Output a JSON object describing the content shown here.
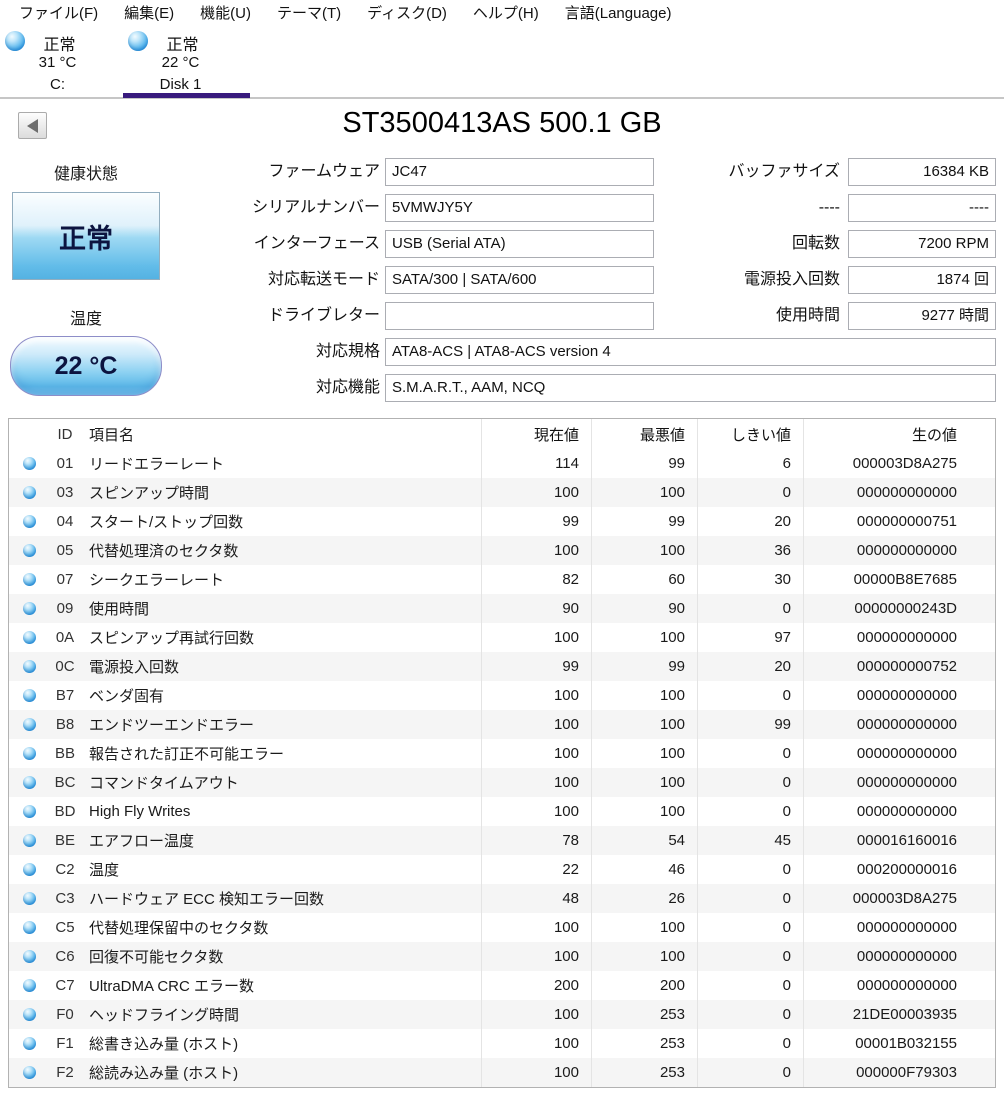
{
  "menu": {
    "items": [
      "ファイル(F)",
      "編集(E)",
      "機能(U)",
      "テーマ(T)",
      "ディスク(D)",
      "ヘルプ(H)",
      "言語(Language)"
    ]
  },
  "disk_tabs": [
    {
      "status": "正常",
      "temp": "31 °C",
      "name": "C:",
      "selected": false
    },
    {
      "status": "正常",
      "temp": "22 °C",
      "name": "Disk 1",
      "selected": true
    }
  ],
  "header": {
    "title": "ST3500413AS 500.1 GB"
  },
  "health": {
    "label": "健康状態",
    "status": "正常"
  },
  "temperature": {
    "label": "温度",
    "value": "22 °C"
  },
  "info_left": [
    {
      "label": "ファームウェア",
      "value": "JC47"
    },
    {
      "label": "シリアルナンバー",
      "value": "5VMWJY5Y"
    },
    {
      "label": "インターフェース",
      "value": "USB (Serial ATA)"
    },
    {
      "label": "対応転送モード",
      "value": "SATA/300 | SATA/600"
    },
    {
      "label": "ドライブレター",
      "value": ""
    }
  ],
  "info_right": [
    {
      "label": "バッファサイズ",
      "value": "16384 KB"
    },
    {
      "label": "----",
      "value": "----"
    },
    {
      "label": "回転数",
      "value": "7200 RPM"
    },
    {
      "label": "電源投入回数",
      "value": "1874 回"
    },
    {
      "label": "使用時間",
      "value": "9277 時間"
    }
  ],
  "info_wide": [
    {
      "label": "対応規格",
      "value": "ATA8-ACS | ATA8-ACS version 4"
    },
    {
      "label": "対応機能",
      "value": "S.M.A.R.T., AAM, NCQ"
    }
  ],
  "smart_table": {
    "headers": {
      "id": "ID",
      "name": "項目名",
      "current": "現在値",
      "worst": "最悪値",
      "threshold": "しきい値",
      "raw": "生の値"
    },
    "rows": [
      {
        "id": "01",
        "name": "リードエラーレート",
        "current": "114",
        "worst": "99",
        "threshold": "6",
        "raw": "000003D8A275"
      },
      {
        "id": "03",
        "name": "スピンアップ時間",
        "current": "100",
        "worst": "100",
        "threshold": "0",
        "raw": "000000000000"
      },
      {
        "id": "04",
        "name": "スタート/ストップ回数",
        "current": "99",
        "worst": "99",
        "threshold": "20",
        "raw": "000000000751"
      },
      {
        "id": "05",
        "name": "代替処理済のセクタ数",
        "current": "100",
        "worst": "100",
        "threshold": "36",
        "raw": "000000000000"
      },
      {
        "id": "07",
        "name": "シークエラーレート",
        "current": "82",
        "worst": "60",
        "threshold": "30",
        "raw": "00000B8E7685"
      },
      {
        "id": "09",
        "name": "使用時間",
        "current": "90",
        "worst": "90",
        "threshold": "0",
        "raw": "00000000243D"
      },
      {
        "id": "0A",
        "name": "スピンアップ再試行回数",
        "current": "100",
        "worst": "100",
        "threshold": "97",
        "raw": "000000000000"
      },
      {
        "id": "0C",
        "name": "電源投入回数",
        "current": "99",
        "worst": "99",
        "threshold": "20",
        "raw": "000000000752"
      },
      {
        "id": "B7",
        "name": "ベンダ固有",
        "current": "100",
        "worst": "100",
        "threshold": "0",
        "raw": "000000000000"
      },
      {
        "id": "B8",
        "name": "エンドツーエンドエラー",
        "current": "100",
        "worst": "100",
        "threshold": "99",
        "raw": "000000000000"
      },
      {
        "id": "BB",
        "name": "報告された訂正不可能エラー",
        "current": "100",
        "worst": "100",
        "threshold": "0",
        "raw": "000000000000"
      },
      {
        "id": "BC",
        "name": "コマンドタイムアウト",
        "current": "100",
        "worst": "100",
        "threshold": "0",
        "raw": "000000000000"
      },
      {
        "id": "BD",
        "name": "High Fly Writes",
        "current": "100",
        "worst": "100",
        "threshold": "0",
        "raw": "000000000000"
      },
      {
        "id": "BE",
        "name": "エアフロー温度",
        "current": "78",
        "worst": "54",
        "threshold": "45",
        "raw": "000016160016"
      },
      {
        "id": "C2",
        "name": "温度",
        "current": "22",
        "worst": "46",
        "threshold": "0",
        "raw": "000200000016"
      },
      {
        "id": "C3",
        "name": "ハードウェア ECC 検知エラー回数",
        "current": "48",
        "worst": "26",
        "threshold": "0",
        "raw": "000003D8A275"
      },
      {
        "id": "C5",
        "name": "代替処理保留中のセクタ数",
        "current": "100",
        "worst": "100",
        "threshold": "0",
        "raw": "000000000000"
      },
      {
        "id": "C6",
        "name": "回復不可能セクタ数",
        "current": "100",
        "worst": "100",
        "threshold": "0",
        "raw": "000000000000"
      },
      {
        "id": "C7",
        "name": "UltraDMA CRC エラー数",
        "current": "200",
        "worst": "200",
        "threshold": "0",
        "raw": "000000000000"
      },
      {
        "id": "F0",
        "name": "ヘッドフライング時間",
        "current": "100",
        "worst": "253",
        "threshold": "0",
        "raw": "21DE00003935"
      },
      {
        "id": "F1",
        "name": "総書き込み量 (ホスト)",
        "current": "100",
        "worst": "253",
        "threshold": "0",
        "raw": "00001B032155"
      },
      {
        "id": "F2",
        "name": "総読み込み量 (ホスト)",
        "current": "100",
        "worst": "253",
        "threshold": "0",
        "raw": "000000F79303"
      }
    ]
  },
  "colors": {
    "accent_purple": "#381a7d",
    "status_good_blue": "#2f9ee8",
    "health_text": "#0c1440"
  }
}
